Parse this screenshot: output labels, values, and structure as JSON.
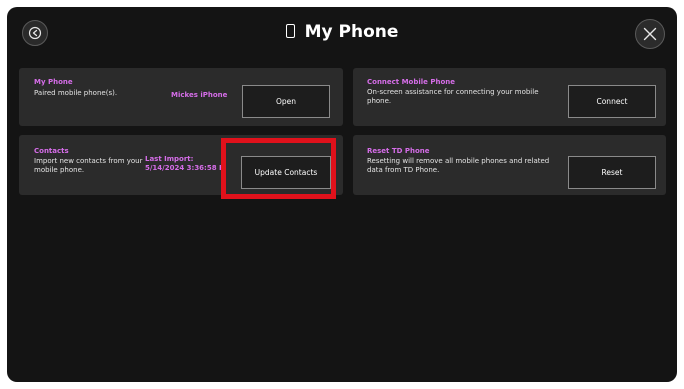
{
  "window": {
    "title": "My Phone",
    "icons": {
      "back": "back-arrow-icon",
      "close": "close-icon",
      "title": "phone-icon"
    }
  },
  "cards": {
    "my_phone": {
      "title": "My Phone",
      "description": "Paired mobile phone(s).",
      "device_name": "Mickes iPhone",
      "button_label": "Open"
    },
    "connect": {
      "title": "Connect Mobile Phone",
      "description": "On-screen assistance for connecting your mobile phone.",
      "button_label": "Connect"
    },
    "contacts": {
      "title": "Contacts",
      "description": "Import new contacts from your mobile phone.",
      "last_import_label": "Last Import:",
      "last_import_value": "5/14/2024 3:36:58 P",
      "button_label": "Update Contacts"
    },
    "reset": {
      "title": "Reset TD Phone",
      "description": "Resetting will remove all mobile phones and related data from TD Phone.",
      "button_label": "Reset"
    }
  },
  "colors": {
    "background": "#141414",
    "card": "#2b2b2b",
    "accent": "#d56de8",
    "highlight": "#e0111b"
  }
}
